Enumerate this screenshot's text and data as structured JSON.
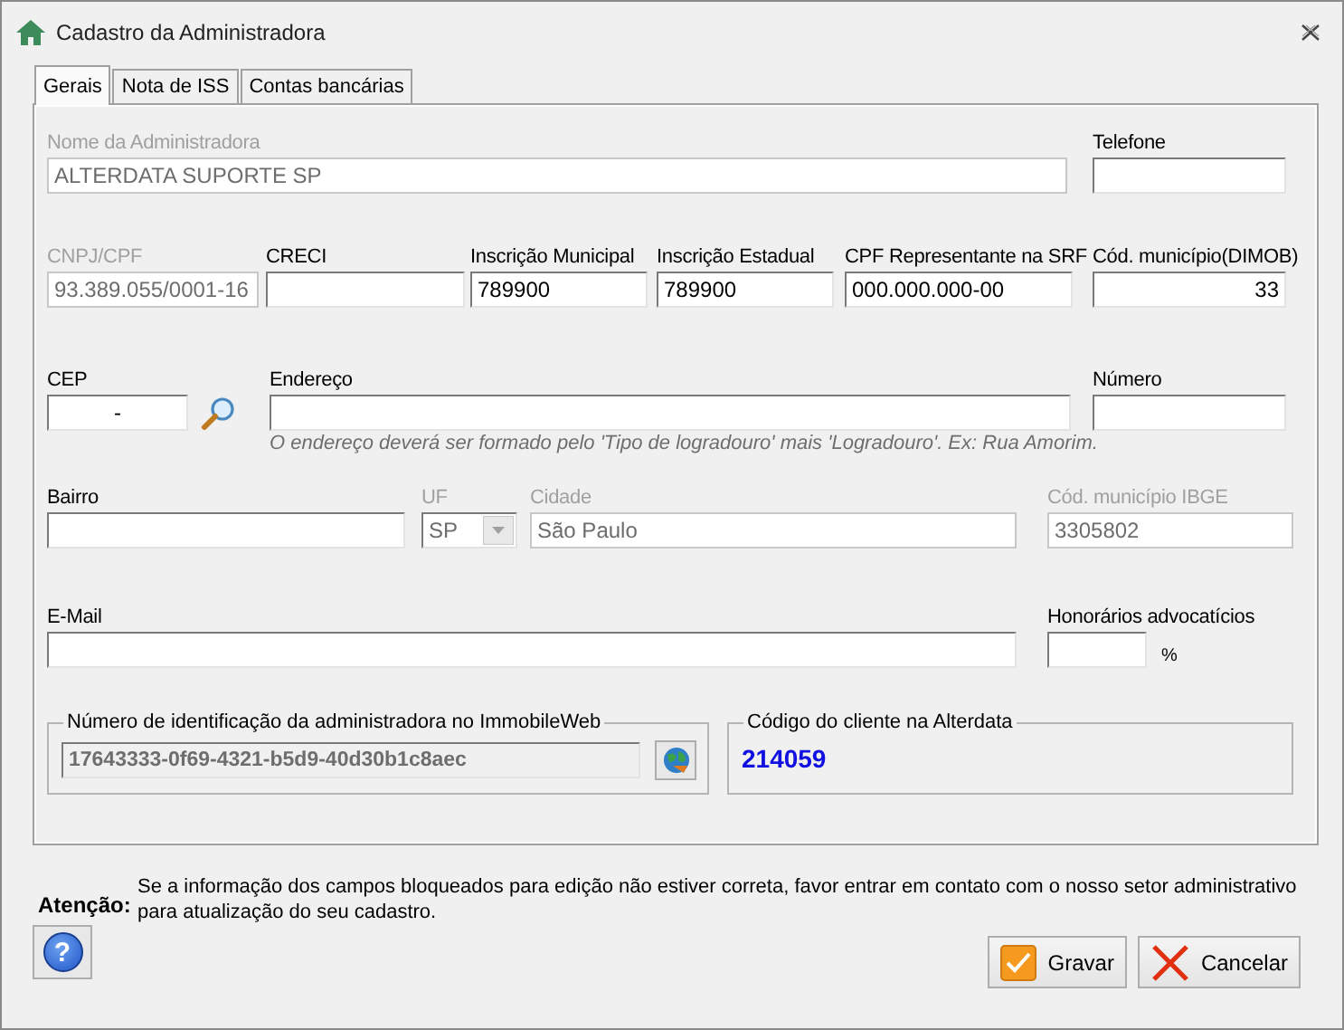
{
  "window": {
    "title": "Cadastro da Administradora"
  },
  "tabs": [
    {
      "label": "Gerais",
      "selected": true
    },
    {
      "label": "Nota de ISS",
      "selected": false
    },
    {
      "label": "Contas bancárias",
      "selected": false
    }
  ],
  "rows": [
    {
      "fields": [
        {
          "kind": "text",
          "label": "Nome da Administradora",
          "value": "ALTERDATA SUPORTE SP",
          "disabled": true
        },
        {
          "kind": "text",
          "label": "Telefone",
          "disabled": false
        }
      ]
    },
    {
      "fields": [
        {
          "kind": "text",
          "label": "CNPJ/CPF",
          "value": "93.389.055/0001-16",
          "disabled": true
        },
        {
          "kind": "text",
          "label": "CRECI",
          "disabled": false
        },
        {
          "kind": "text",
          "label": "Inscrição Municipal",
          "value": "789900",
          "disabled": false
        },
        {
          "kind": "text",
          "label": "Inscrição Estadual",
          "value": "789900",
          "disabled": false
        },
        {
          "kind": "text",
          "label": "CPF Representante na SRF",
          "value": "000.000.000-00",
          "disabled": false
        },
        {
          "kind": "number",
          "label": "Cód. município(DIMOB)",
          "value": "33",
          "disabled": false
        }
      ]
    },
    {
      "fields": [
        {
          "kind": "search",
          "label": "CEP",
          "value": "-",
          "disabled": false
        },
        {
          "kind": "text",
          "label": "Endereço",
          "hint": "O endereço deverá ser formado pelo 'Tipo de logradouro' mais 'Logradouro'. Ex: Rua Amorim.",
          "disabled": false
        },
        {
          "kind": "text",
          "label": "Número",
          "disabled": false
        }
      ]
    },
    {
      "fields": [
        {
          "kind": "text",
          "label": "Bairro",
          "disabled": false
        },
        {
          "kind": "select",
          "label": "UF",
          "value": "SP",
          "disabled": true
        },
        {
          "kind": "text",
          "label": "Cidade",
          "value": "São Paulo",
          "disabled": true
        },
        {
          "kind": "text",
          "label": "Cód. município IBGE",
          "value": "3305802",
          "disabled": true
        }
      ]
    },
    {
      "fields": [
        {
          "kind": "text",
          "label": "E-Mail",
          "disabled": false
        },
        {
          "kind": "percent",
          "label": "Honorários advocatícios",
          "suffix": "%",
          "disabled": false
        }
      ]
    }
  ],
  "immobile_group": {
    "legend": "Número de identificação da administradora no ImmobileWeb",
    "value": "17643333-0f69-4321-b5d9-40d30b1c8aec"
  },
  "client_group": {
    "legend": "Código do cliente na Alterdata",
    "value": "214059"
  },
  "notice": {
    "label": "Atenção:",
    "text": "Se a informação dos campos bloqueados para edição não estiver correta, favor entrar em contato com o nosso setor administrativo para atualização do seu cadastro."
  },
  "help_button": {
    "symbol": "?"
  },
  "buttons": [
    {
      "kind": "save",
      "label": "Gravar"
    },
    {
      "kind": "cancel",
      "label": "Cancelar"
    }
  ]
}
